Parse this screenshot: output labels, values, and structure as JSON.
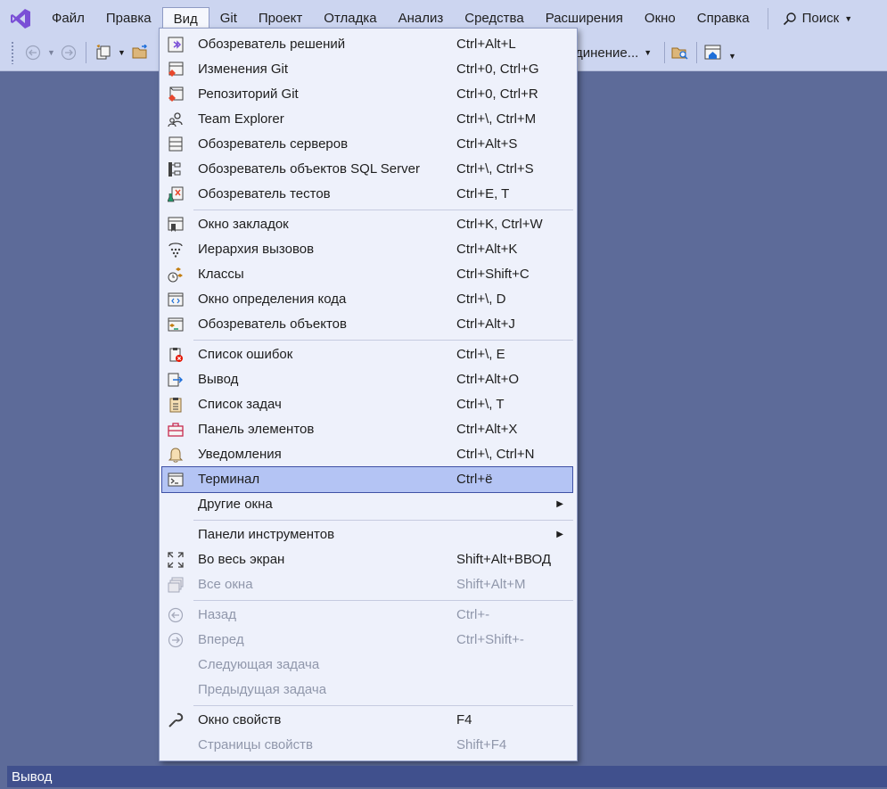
{
  "menubar": {
    "items": [
      "Файл",
      "Правка",
      "Вид",
      "Git",
      "Проект",
      "Отладка",
      "Анализ",
      "Средства",
      "Расширения",
      "Окно",
      "Справка"
    ],
    "active_index": 2,
    "search_label": "Поиск"
  },
  "toolbar": {
    "config_label": "единение..."
  },
  "menu": {
    "items": [
      {
        "label": "Обозреватель решений",
        "shortcut": "Ctrl+Alt+L",
        "icon": "solution-explorer-icon"
      },
      {
        "label": "Изменения Git",
        "shortcut": "Ctrl+0, Ctrl+G",
        "icon": "git-changes-icon"
      },
      {
        "label": "Репозиторий Git",
        "shortcut": "Ctrl+0, Ctrl+R",
        "icon": "git-repository-icon"
      },
      {
        "label": "Team Explorer",
        "shortcut": "Ctrl+\\, Ctrl+M",
        "icon": "team-explorer-icon"
      },
      {
        "label": "Обозреватель серверов",
        "shortcut": "Ctrl+Alt+S",
        "icon": "server-explorer-icon"
      },
      {
        "label": "Обозреватель объектов SQL Server",
        "shortcut": "Ctrl+\\, Ctrl+S",
        "icon": "sql-object-explorer-icon"
      },
      {
        "label": "Обозреватель тестов",
        "shortcut": "Ctrl+E, T",
        "icon": "test-explorer-icon"
      },
      {
        "label": "Окно закладок",
        "shortcut": "Ctrl+K, Ctrl+W",
        "icon": "bookmark-window-icon"
      },
      {
        "label": "Иерархия вызовов",
        "shortcut": "Ctrl+Alt+K",
        "icon": "call-hierarchy-icon"
      },
      {
        "label": "Классы",
        "shortcut": "Ctrl+Shift+C",
        "icon": "class-view-icon"
      },
      {
        "label": "Окно определения кода",
        "shortcut": "Ctrl+\\, D",
        "icon": "code-definition-icon"
      },
      {
        "label": "Обозреватель объектов",
        "shortcut": "Ctrl+Alt+J",
        "icon": "object-browser-icon"
      },
      {
        "label": "Список ошибок",
        "shortcut": "Ctrl+\\, E",
        "icon": "error-list-icon"
      },
      {
        "label": "Вывод",
        "shortcut": "Ctrl+Alt+O",
        "icon": "output-icon"
      },
      {
        "label": "Список задач",
        "shortcut": "Ctrl+\\, T",
        "icon": "task-list-icon"
      },
      {
        "label": "Панель элементов",
        "shortcut": "Ctrl+Alt+X",
        "icon": "toolbox-icon"
      },
      {
        "label": "Уведомления",
        "shortcut": "Ctrl+\\, Ctrl+N",
        "icon": "bell-icon"
      },
      {
        "label": "Терминал",
        "shortcut": "Ctrl+ё",
        "icon": "terminal-icon"
      },
      {
        "label": "Другие окна",
        "shortcut": "",
        "icon": ""
      },
      {
        "label": "Панели инструментов",
        "shortcut": "",
        "icon": ""
      },
      {
        "label": "Во весь экран",
        "shortcut": "Shift+Alt+ВВОД",
        "icon": "fullscreen-icon"
      },
      {
        "label": "Все окна",
        "shortcut": "Shift+Alt+M",
        "icon": "all-windows-icon"
      },
      {
        "label": "Назад",
        "shortcut": "Ctrl+-",
        "icon": "back-icon"
      },
      {
        "label": "Вперед",
        "shortcut": "Ctrl+Shift+-",
        "icon": "forward-icon"
      },
      {
        "label": "Следующая задача",
        "shortcut": "",
        "icon": ""
      },
      {
        "label": "Предыдущая задача",
        "shortcut": "",
        "icon": ""
      },
      {
        "label": "Окно свойств",
        "shortcut": "F4",
        "icon": "wrench-icon"
      },
      {
        "label": "Страницы свойств",
        "shortcut": "Shift+F4",
        "icon": ""
      }
    ]
  },
  "statusbar": {
    "label": "Вывод"
  },
  "colors": {
    "workspace": "#5d6b99",
    "chrome": "#ccd5f0",
    "menu_bg": "#eef1fb",
    "selected": "#b4c4f4",
    "statusbar": "#40508d",
    "vs_purple": "#7a4fd6"
  }
}
